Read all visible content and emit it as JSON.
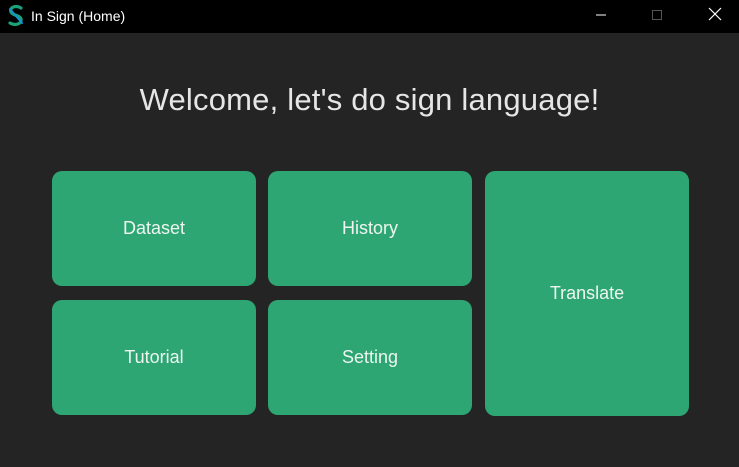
{
  "window": {
    "title": "In Sign (Home)",
    "icon": "in-sign-logo-icon",
    "controls": [
      "minimize-icon",
      "maximize-icon",
      "close-icon"
    ]
  },
  "main": {
    "heading": "Welcome, let's do sign language!",
    "tiles": {
      "dataset": "Dataset",
      "history": "History",
      "tutorial": "Tutorial",
      "setting": "Setting",
      "translate": "Translate"
    }
  },
  "colors": {
    "background": "#242424",
    "titlebar": "#000000",
    "tile": "#2ea673",
    "text": "#e6e6e6"
  }
}
